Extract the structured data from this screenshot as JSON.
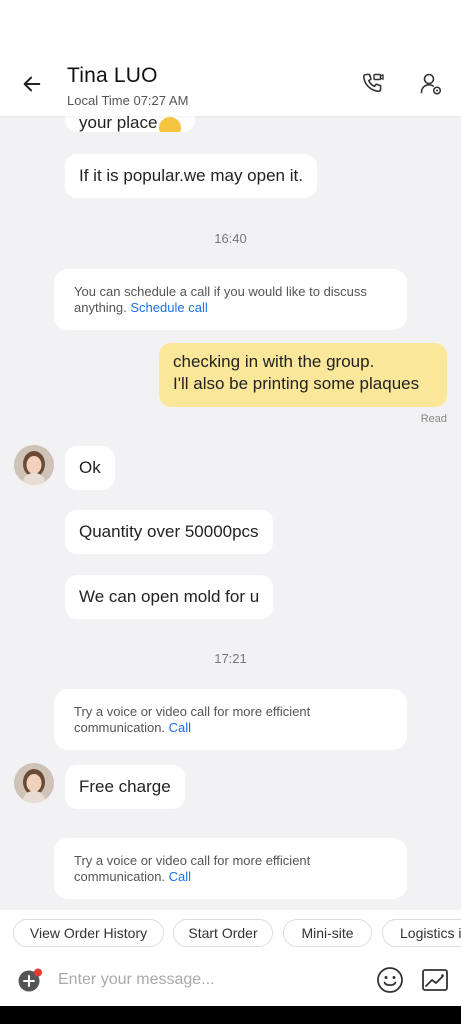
{
  "header": {
    "name": "Tina LUO",
    "local_time": "Local Time 07:27 AM"
  },
  "messages": {
    "partial_top": "your place",
    "m1": "If it is popular.we may open it.",
    "time1": "16:40",
    "sys1_text": "You can schedule a call if you would like to discuss anything.",
    "sys1_link": "Schedule call",
    "out1_line1": "checking in with the group.",
    "out1_line2": "I'll also be printing some plaques",
    "read_label": "Read",
    "m2": "Ok",
    "m3": "Quantity over 50000pcs",
    "m4": "We can open mold for u",
    "time2": "17:21",
    "sys2_text": "Try a voice or video call for more efficient communication.",
    "sys2_link": "Call",
    "m5": "Free charge",
    "sys3_text": "Try a voice or video call for more efficient communication.",
    "sys3_link": "Call"
  },
  "quick_actions": [
    "View Order History",
    "Start Order",
    "Mini-site",
    "Logistics i"
  ],
  "composer": {
    "placeholder": "Enter your message..."
  },
  "colors": {
    "outgoing_bubble": "#fbe79a",
    "link": "#1a73e8",
    "notification_dot": "#e53935"
  }
}
